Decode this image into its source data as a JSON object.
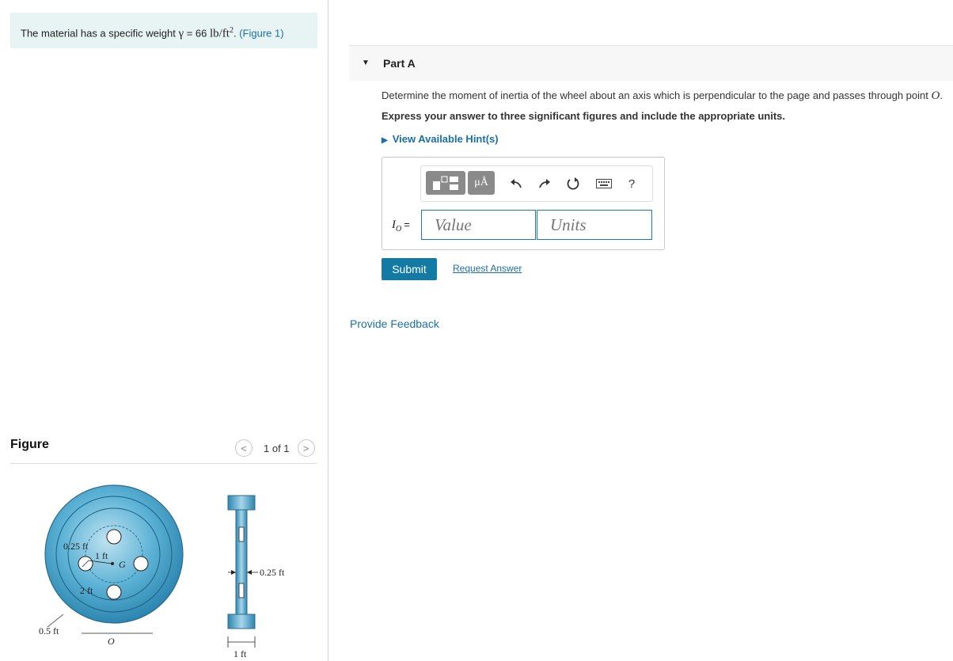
{
  "problem": {
    "text_prefix": "The material has a specific weight ",
    "gamma": "γ",
    "equals": " = 66 ",
    "unit": "lb/ft",
    "unit_exp": "2",
    "period": ". ",
    "figure_link": "(Figure 1)"
  },
  "figure": {
    "title": "Figure",
    "pager_prev": "<",
    "pager_count": "1 of 1",
    "pager_next": ">",
    "labels": {
      "r_hole": "0.25 ft",
      "r_gc": "1 ft",
      "g": "G",
      "r_inner": "2 ft",
      "r_outer": "0.5 ft",
      "o": "O",
      "thickness": "0.25 ft",
      "width": "1 ft"
    },
    "colors": {
      "wheel": "#3a9fc8",
      "wheel_light": "#bfe2f0"
    }
  },
  "part": {
    "title": "Part A",
    "question": "Determine the moment of inertia of the wheel about an axis which is perpendicular to the page and passes through point ",
    "question_point": "O",
    "question_end": ".",
    "instruction": "Express your answer to three significant figures and include the appropriate units.",
    "hint": "View Available Hint(s)"
  },
  "toolbar": {
    "units_symbol": "μÅ",
    "help": "?"
  },
  "answer": {
    "label": "I",
    "label_sub": "O",
    "equals": "=",
    "value_placeholder": "Value",
    "units_placeholder": "Units"
  },
  "actions": {
    "submit": "Submit",
    "request": "Request Answer",
    "feedback": "Provide Feedback"
  },
  "accent_color": "#137aa4"
}
